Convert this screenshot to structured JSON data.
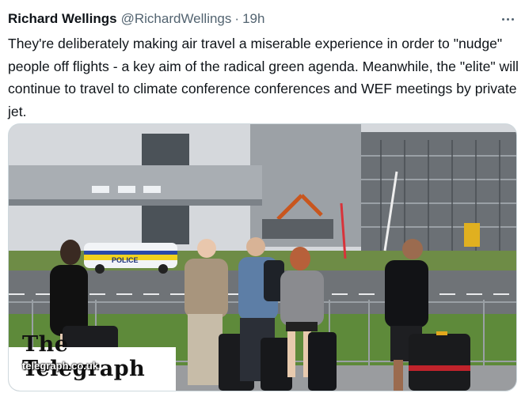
{
  "tweet": {
    "author_name": "Richard Wellings",
    "handle": "@RichardWellings",
    "separator": "·",
    "time": "19h",
    "text": "They're deliberately making air travel a miserable experience in order to \"nudge\" people off flights - a key aim of the radical green agenda. Meanwhile, the \"elite\" will continue to travel to climate conference conferences and WEF meetings by private jet."
  },
  "media": {
    "police_car_label": "POLICE",
    "watermark_domain": "telegraph.co.uk",
    "watermark_logo": "The Telegraph"
  },
  "icons": {
    "more": "more-horizontal-icon"
  }
}
